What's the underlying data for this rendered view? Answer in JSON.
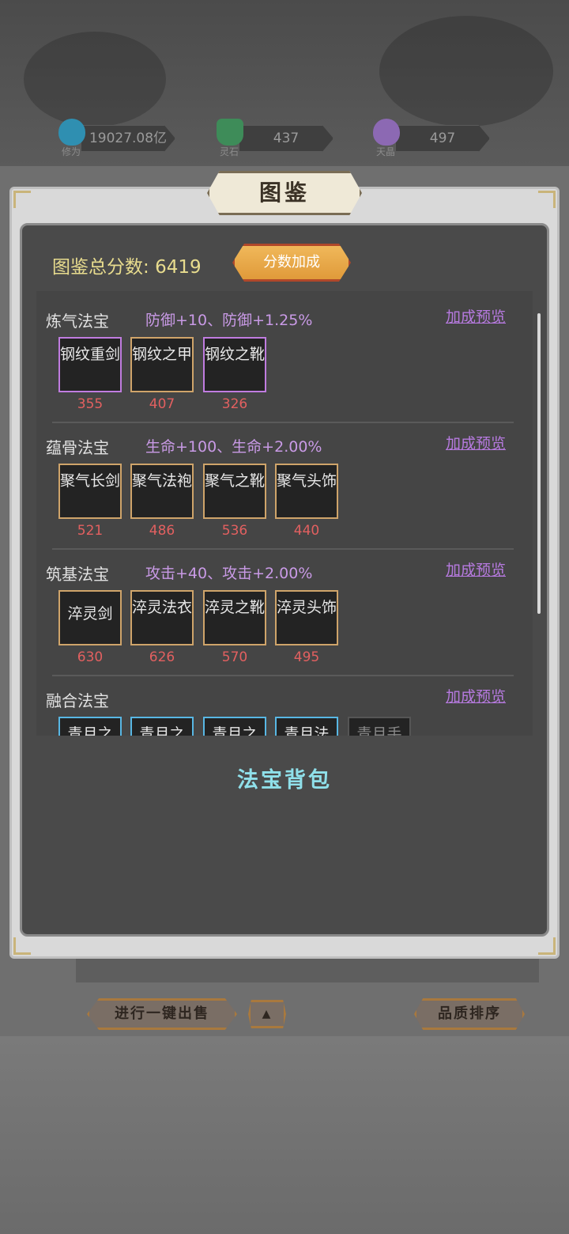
{
  "resources": [
    {
      "value": "19027.08亿",
      "label": "修为",
      "icon": "water-flame-icon",
      "color": "#3aa6c9"
    },
    {
      "value": "437",
      "label": "灵石",
      "icon": "crystal-icon",
      "color": "#4da36b"
    },
    {
      "value": "497",
      "label": "天晶",
      "icon": "purple-gem-icon",
      "color": "#a77dd0"
    }
  ],
  "panel": {
    "title": "图鉴",
    "score_label": "图鉴总分数:",
    "score_value": "6419",
    "bonus_button": "分数加成"
  },
  "categories": [
    {
      "name": "炼气法宝",
      "bonus": "防御+10、防御+1.25%",
      "preview": "加成预览",
      "items": [
        {
          "name": "钢纹重剑",
          "score": "355",
          "quality": "purple"
        },
        {
          "name": "钢纹之甲",
          "score": "407",
          "quality": "gold"
        },
        {
          "name": "钢纹之靴",
          "score": "326",
          "quality": "purple"
        }
      ]
    },
    {
      "name": "蕴骨法宝",
      "bonus": "生命+100、生命+2.00%",
      "preview": "加成预览",
      "items": [
        {
          "name": "聚气长剑",
          "score": "521",
          "quality": "gold"
        },
        {
          "name": "聚气法袍",
          "score": "486",
          "quality": "gold"
        },
        {
          "name": "聚气之靴",
          "score": "536",
          "quality": "gold"
        },
        {
          "name": "聚气头饰",
          "score": "440",
          "quality": "gold"
        }
      ]
    },
    {
      "name": "筑基法宝",
      "bonus": "攻击+40、攻击+2.00%",
      "preview": "加成预览",
      "items": [
        {
          "name": "淬灵剑",
          "score": "630",
          "quality": "gold"
        },
        {
          "name": "淬灵法衣",
          "score": "626",
          "quality": "gold"
        },
        {
          "name": "淬灵之靴",
          "score": "570",
          "quality": "gold"
        },
        {
          "name": "淬灵头饰",
          "score": "495",
          "quality": "gold"
        }
      ]
    },
    {
      "name": "融合法宝",
      "bonus": "",
      "preview": "加成预览",
      "items": [
        {
          "name": "青月之",
          "score": "",
          "quality": "blue"
        },
        {
          "name": "青月之",
          "score": "",
          "quality": "blue"
        },
        {
          "name": "青月之",
          "score": "",
          "quality": "blue"
        },
        {
          "name": "青月法",
          "score": "",
          "quality": "blue"
        },
        {
          "name": "青月手",
          "score": "",
          "quality": "gray"
        }
      ]
    }
  ],
  "bag": {
    "title": "法宝背包"
  },
  "footer": {
    "sell_button": "进行一键出售",
    "up_arrow": "▲",
    "sort_button": "品质排序"
  }
}
